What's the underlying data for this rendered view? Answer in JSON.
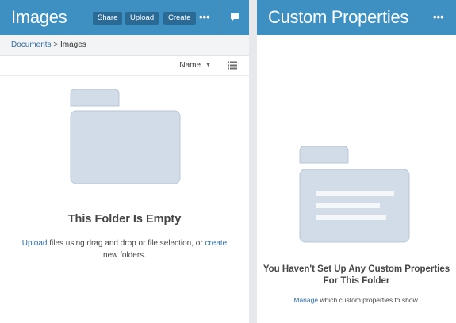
{
  "left_panel": {
    "title": "Images",
    "buttons": {
      "share": "Share",
      "upload": "Upload",
      "create": "Create"
    },
    "more": "•••",
    "breadcrumb": {
      "root": "Documents",
      "separator": ">",
      "current": "Images"
    },
    "sort_label": "Name",
    "empty_title": "This Folder Is Empty",
    "empty_text": {
      "upload_link": "Upload",
      "middle": " files using drag and drop or file selection, or ",
      "create_link": "create",
      "end": "new folders."
    }
  },
  "right_panel": {
    "title": "Custom Properties",
    "more": "•••",
    "empty_title_line1": "You Haven't Set Up Any Custom Properties",
    "empty_title_line2": "For This Folder",
    "manage_link": "Manage",
    "manage_text": " which custom properties to show."
  },
  "icons": [
    "more-icon",
    "comment-icon",
    "chevron-down-icon",
    "list-view-icon",
    "folder-icon"
  ],
  "colors": {
    "header": "#3e90c2",
    "button": "#2b6a95",
    "link": "#2f6ea8",
    "folder_fill": "#d1dce8",
    "folder_stroke": "#b5c4d4"
  }
}
